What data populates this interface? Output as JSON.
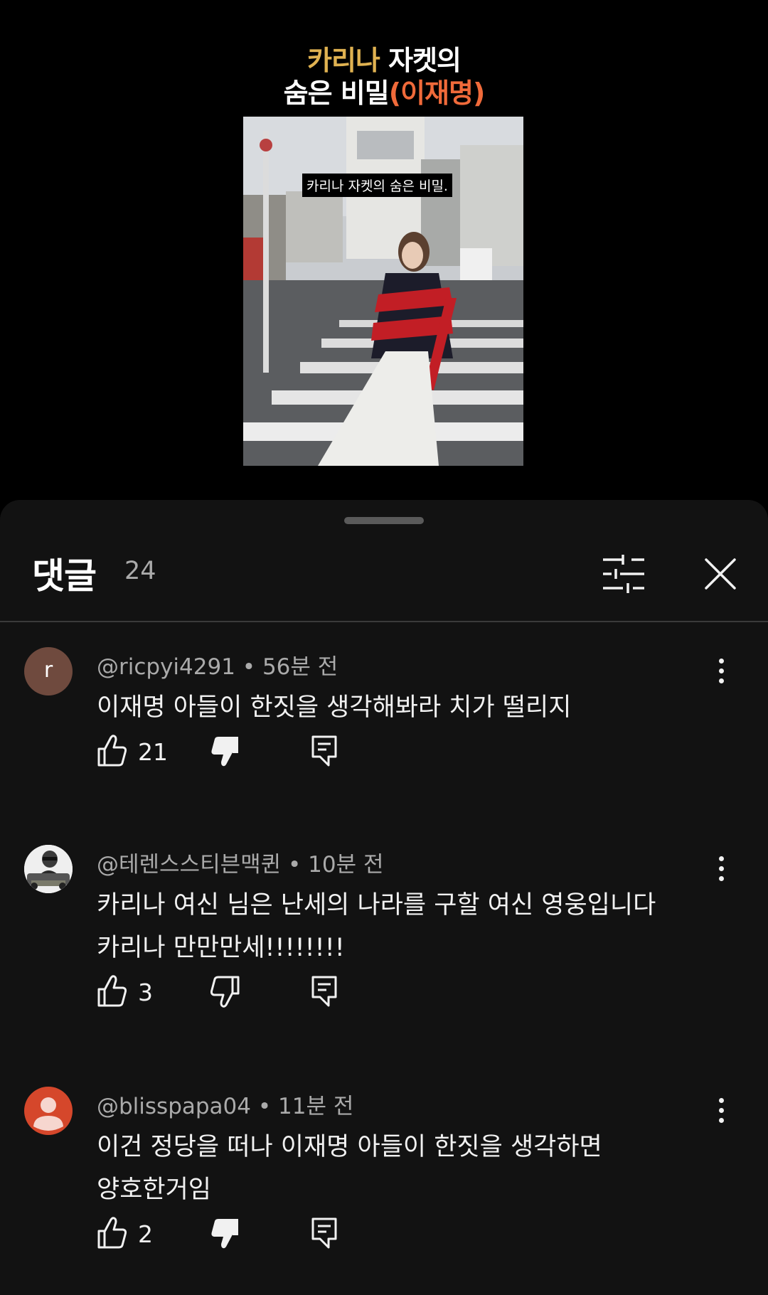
{
  "video": {
    "title_line1_part1": "카리나",
    "title_line1_part2": " 자켓의",
    "title_line2_part1": "숨은 비밀",
    "title_line2_part2": "(이재명)",
    "caption": "카리나 자켓의 숨은 비밀."
  },
  "comments_sheet": {
    "title": "댓글",
    "count": "24",
    "filter_icon": "filter-sliders-icon",
    "close_icon": "close-icon"
  },
  "comments": [
    {
      "avatar_letter": "r",
      "author": "@ricpyi4291",
      "time": "56분 전",
      "lines": [
        "이재명 아들이 한짓을 생각해봐라 치가 떨리지"
      ],
      "likes": "21",
      "disliked": true
    },
    {
      "avatar_letter": "",
      "author": "@테렌스스티븐맥퀸",
      "time": "10분 전",
      "lines": [
        "카리나 여신 님은  난세의 나라를 구할 여신 영웅입니다",
        "카리나  만만만세!!!!!!!!"
      ],
      "likes": "3",
      "disliked": false
    },
    {
      "avatar_letter": "",
      "author": "@blisspapa04",
      "time": "11분 전",
      "lines": [
        "이건 정당을 떠나 이재명 아들이 한짓을 생각하면",
        "양호한거임"
      ],
      "likes": "2",
      "disliked": true
    }
  ],
  "colors": {
    "title_gold": "#e0b251",
    "title_orange": "#f06a3a",
    "sheet_bg": "#121212",
    "avatar_r": "#6f4a3e",
    "avatar_default": "#d5472b"
  }
}
